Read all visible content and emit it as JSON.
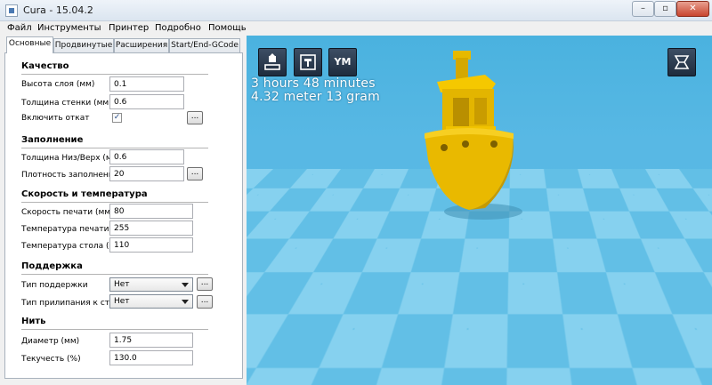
{
  "window": {
    "title": "Cura - 15.04.2",
    "minimize": "–",
    "maximize": "▫",
    "close": "✕"
  },
  "menu": [
    "Файл",
    "Инструменты",
    "Принтер",
    "Подробно",
    "Помощь"
  ],
  "tabs": [
    "Основные",
    "Продвинутые",
    "Расширения",
    "Start/End-GCode"
  ],
  "active_tab": "Основные",
  "sections": {
    "quality": {
      "title": "Качество",
      "layer_height": {
        "label": "Высота слоя (мм)",
        "value": "0.1"
      },
      "wall_thickness": {
        "label": "Толщина стенки (мм)",
        "value": "0.6"
      },
      "retraction": {
        "label": "Включить откат",
        "checked": true,
        "checkmark": "✓",
        "more": "..."
      }
    },
    "fill": {
      "title": "Заполнение",
      "bottom_top": {
        "label": "Толщина Низ/Верх (мм)",
        "value": "0.6"
      },
      "density": {
        "label": "Плотность заполнения",
        "value": "20",
        "more": "..."
      }
    },
    "speed_temp": {
      "title": "Скорость и температура",
      "print_speed": {
        "label": "Скорость печати (мм/с)",
        "value": "80"
      },
      "print_temp": {
        "label": "Температура печати (С)",
        "value": "255"
      },
      "bed_temp": {
        "label": "Температура стола (С)",
        "value": "110"
      }
    },
    "support": {
      "title": "Поддержка",
      "support_type": {
        "label": "Тип поддержки",
        "value": "Нет",
        "more": "..."
      },
      "adhesion_type": {
        "label": "Тип прилипания к столу",
        "value": "Нет",
        "more": "..."
      }
    },
    "filament": {
      "title": "Нить",
      "diameter": {
        "label": "Диаметр (мм)",
        "value": "1.75"
      },
      "flow": {
        "label": "Текучесть (%)",
        "value": "130.0"
      }
    }
  },
  "viewport": {
    "print_time": "3 hours 48 minutes",
    "material": "4.32 meter 13 gram",
    "ym_label": "YM",
    "model_color": "#f2c400",
    "floor_color": "#62bfe6",
    "toolbar_color": "#2a3a50"
  }
}
